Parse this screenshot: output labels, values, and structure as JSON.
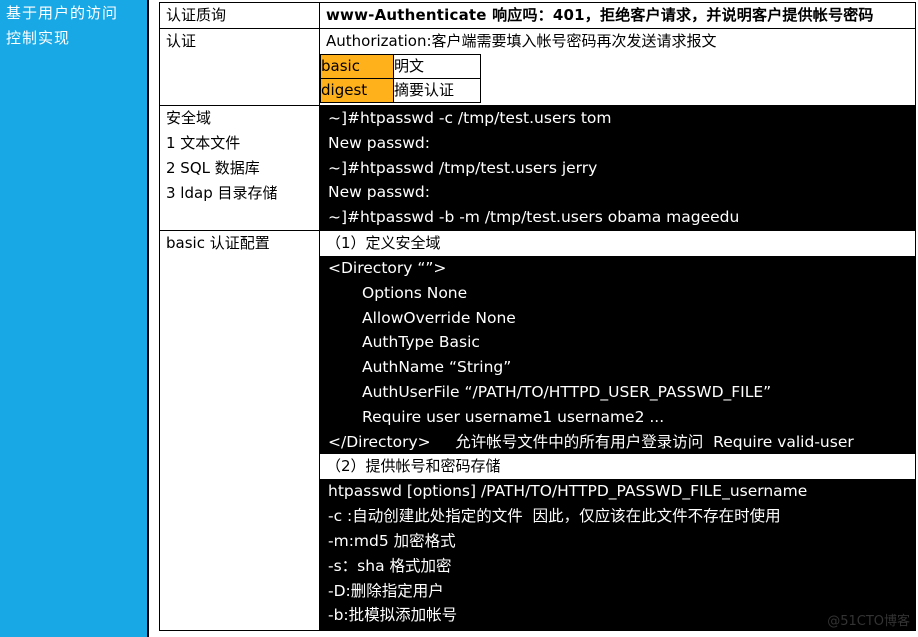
{
  "left": {
    "label": "基于用户的访问\n控制实现"
  },
  "rows": {
    "challenge": {
      "key": "认证质询",
      "value": "www-Authenticate 响应吗：401，拒绝客户请求，并说明客户提供帐号密码"
    },
    "auth": {
      "key": "认证",
      "desc": "Authorization:客户端需要填入帐号密码再次发送请求报文",
      "types": [
        {
          "name": "basic",
          "desc": "明文"
        },
        {
          "name": "digest",
          "desc": "摘要认证"
        }
      ]
    },
    "realm": {
      "key_lines": "安全域\n1 文本文件\n2 SQL 数据库\n3 ldap 目录存储",
      "commands": [
        "~]#htpasswd -c /tmp/test.users tom",
        "New passwd:",
        "~]#htpasswd /tmp/test.users jerry",
        "New passwd:",
        "~]#htpasswd -b -m /tmp/test.users obama mageedu"
      ]
    },
    "basic_config": {
      "key": "basic 认证配置",
      "step1": "（1）定义安全域",
      "dir_open": "<Directory “”>",
      "dir_lines": [
        "Options None",
        "AllowOverride None",
        "AuthType Basic",
        "AuthName “String”",
        "AuthUserFile “/PATH/TO/HTTPD_USER_PASSWD_FILE”",
        "Require user username1 username2 ..."
      ],
      "dir_close": "</Directory>     允许帐号文件中的所有用户登录访问  Require valid-user",
      "step2": "（2）提供帐号和密码存储",
      "htpasswd_lines": [
        "htpasswd [options] /PATH/TO/HTTPD_PASSWD_FILE_username",
        "-c :自动创建此处指定的文件  因此，仅应该在此文件不存在时使用",
        "-m:md5 加密格式",
        "-s：sha 格式加密",
        "-D:删除指定用户",
        "-b:批模拟添加帐号"
      ]
    }
  },
  "watermark": "@51CTO博客"
}
